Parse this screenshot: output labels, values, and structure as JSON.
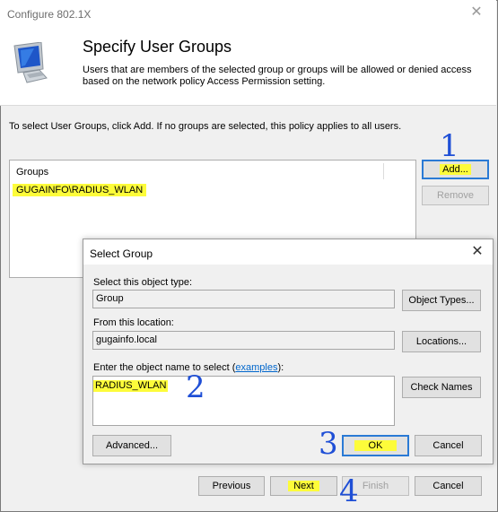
{
  "window": {
    "title": "Configure 802.1X"
  },
  "header": {
    "title": "Specify User Groups",
    "description": "Users that are members of the selected group or groups will be allowed or denied access based on the network policy Access Permission setting.",
    "icon": "monitor-icon"
  },
  "instruction": "To select User Groups, click Add. If no groups are selected, this policy applies to all users.",
  "groups": {
    "header": "Groups",
    "items": [
      "GUGAINFO\\RADIUS_WLAN"
    ],
    "add_label": "Add...",
    "remove_label": "Remove"
  },
  "select_group_dialog": {
    "title": "Select Group",
    "object_type_label": "Select this object type:",
    "object_type_value": "Group",
    "object_types_button": "Object Types...",
    "location_label": "From this location:",
    "location_value": "gugainfo.local",
    "locations_button": "Locations...",
    "enter_label_prefix": "Enter the object name to select (",
    "enter_label_link": "examples",
    "enter_label_suffix": "):",
    "enter_value": "RADIUS_WLAN",
    "check_names_button": "Check Names",
    "advanced_button": "Advanced...",
    "ok_button": "OK",
    "cancel_button": "Cancel"
  },
  "wizard_nav": {
    "previous": "Previous",
    "next": "Next",
    "finish": "Finish",
    "cancel": "Cancel"
  },
  "annotations": [
    "1",
    "2",
    "3",
    "4"
  ],
  "colors": {
    "highlight": "#fdfc3a",
    "annotation": "#1f4fd6",
    "focus": "#2a7ad5"
  }
}
